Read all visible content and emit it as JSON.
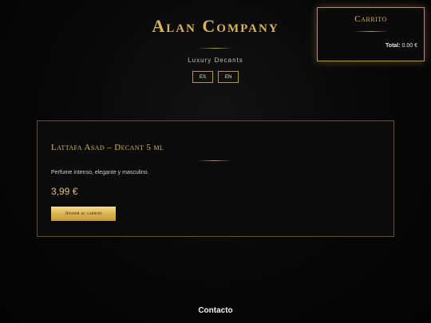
{
  "brand": {
    "title": "Alan Company",
    "subtitle": "Luxury Decants",
    "languages": [
      "ES",
      "EN"
    ]
  },
  "cart": {
    "title": "Carrito",
    "total_label": "Total:",
    "total_value": "0.00 €"
  },
  "product": {
    "name": "Lattafa Asad – Decant 5 ml",
    "description": "Perfume intenso, elegante y masculino.",
    "price": "3,99 €",
    "add_label": "Añadir al carrito"
  },
  "footer": {
    "contact_label": "Contacto"
  },
  "colors": {
    "gold": "#d9b45a",
    "background": "#050505",
    "border": "#b8953f"
  }
}
